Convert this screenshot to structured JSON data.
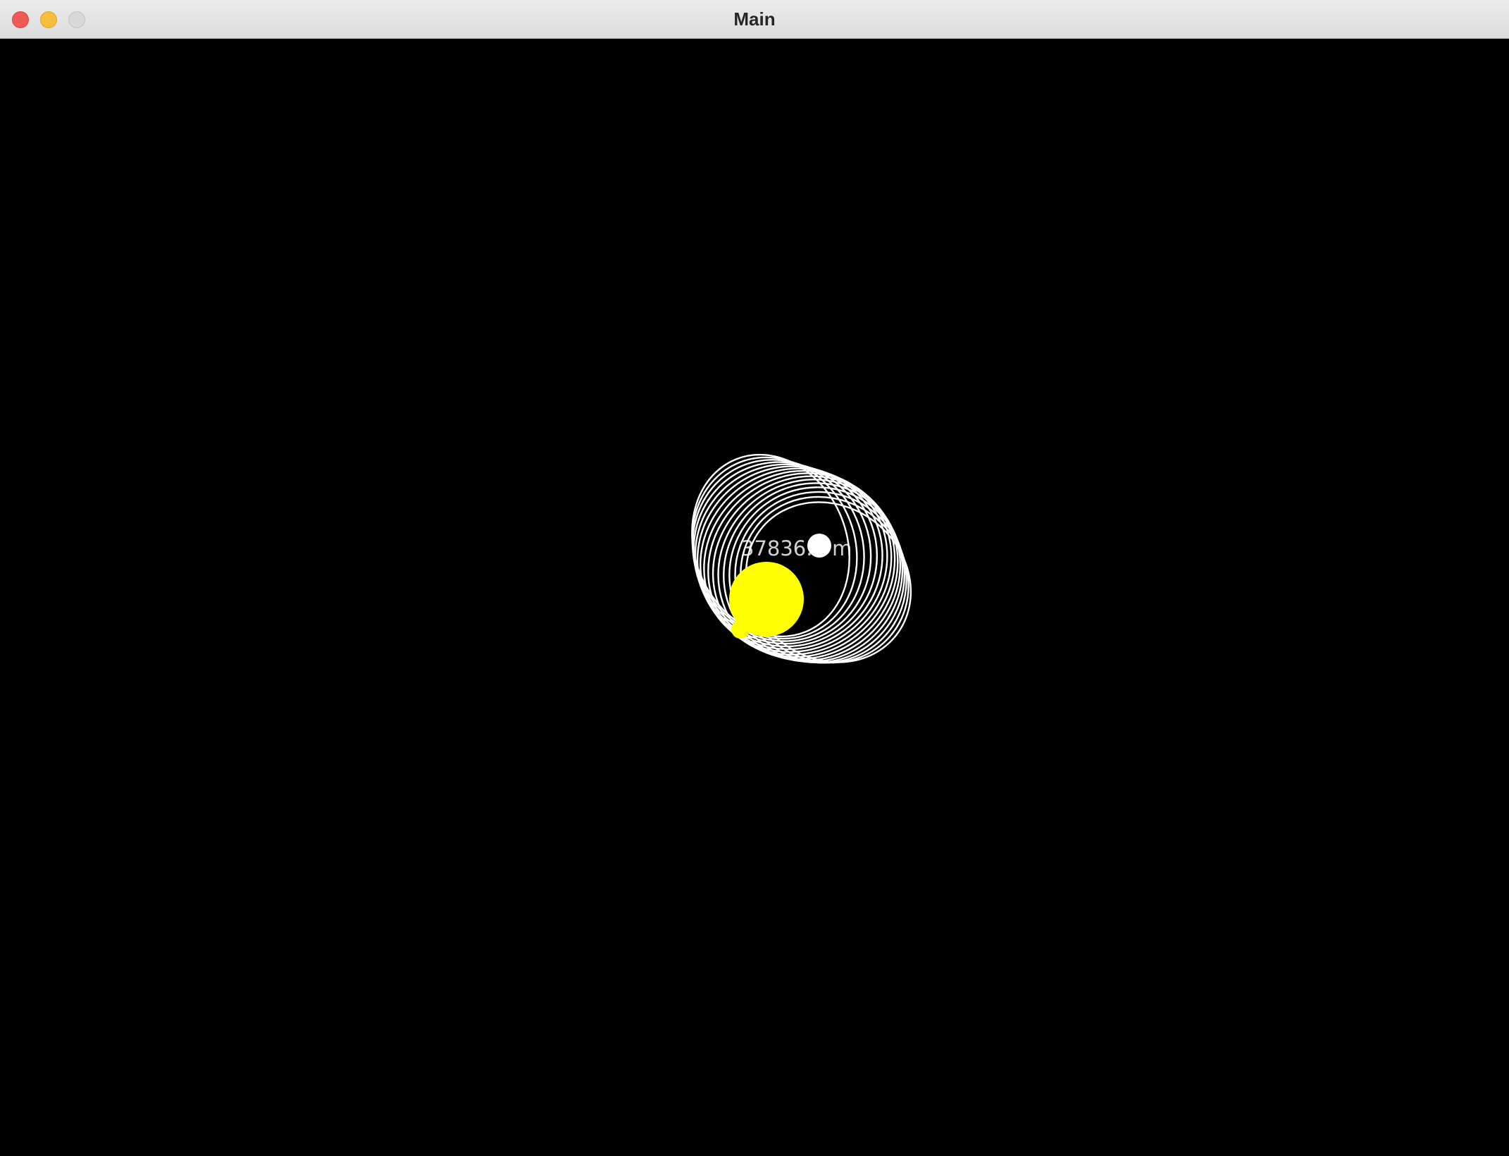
{
  "window": {
    "title": "Main"
  },
  "simulation": {
    "distance_label": "37836... m",
    "colors": {
      "background": "#000000",
      "star": "#ffff00",
      "planet": "#ffffff",
      "orbit_trail": "#ffffff"
    }
  }
}
